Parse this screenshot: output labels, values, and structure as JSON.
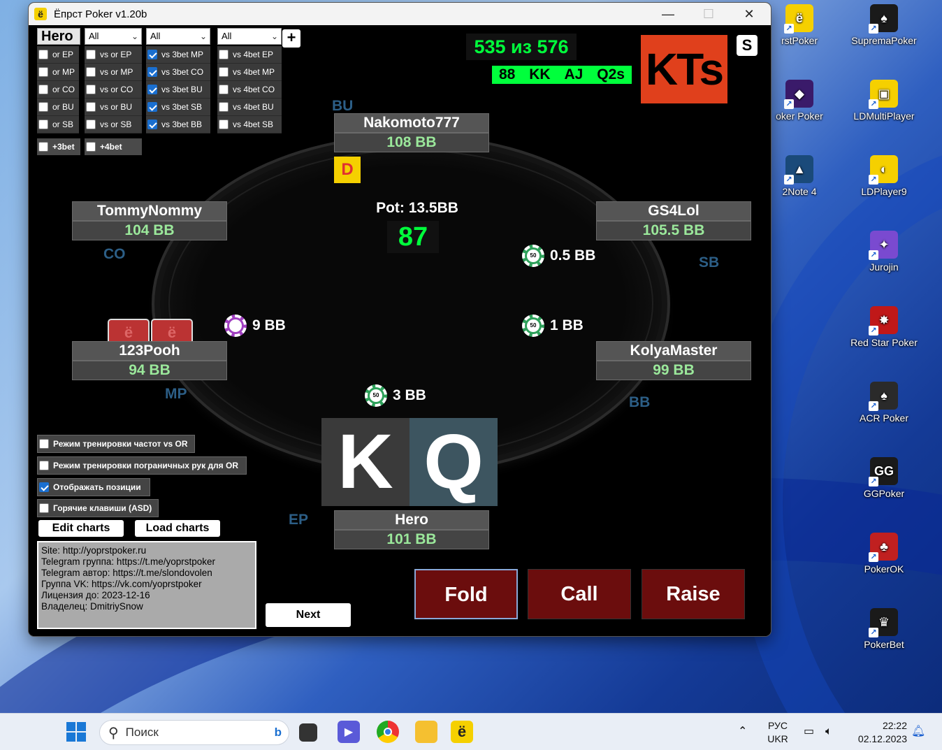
{
  "window": {
    "title": "Ёпрст Poker v1.20b",
    "minimize": "—",
    "maximize": "☐",
    "close": "✕",
    "app_glyph": "ё"
  },
  "filters": {
    "hero": "Hero",
    "dropdowns": [
      "All",
      "All",
      "All"
    ],
    "plus": "+",
    "col1": [
      {
        "label": "or EP",
        "checked": false
      },
      {
        "label": "or MP",
        "checked": false
      },
      {
        "label": "or CO",
        "checked": false
      },
      {
        "label": "or BU",
        "checked": false
      },
      {
        "label": "or SB",
        "checked": false
      }
    ],
    "col2": [
      {
        "label": "vs or EP",
        "checked": false
      },
      {
        "label": "vs or MP",
        "checked": false
      },
      {
        "label": "vs or CO",
        "checked": false
      },
      {
        "label": "vs or BU",
        "checked": false
      },
      {
        "label": "vs or SB",
        "checked": false
      }
    ],
    "col3": [
      {
        "label": "vs 3bet MP",
        "checked": true
      },
      {
        "label": "vs 3bet CO",
        "checked": true
      },
      {
        "label": "vs 3bet BU",
        "checked": true
      },
      {
        "label": "vs 3bet SB",
        "checked": true
      },
      {
        "label": "vs 3bet BB",
        "checked": true
      }
    ],
    "col4": [
      {
        "label": "vs 4bet EP",
        "checked": false
      },
      {
        "label": "vs 4bet MP",
        "checked": false
      },
      {
        "label": "vs 4bet CO",
        "checked": false
      },
      {
        "label": "vs 4bet BU",
        "checked": false
      },
      {
        "label": "vs 4bet SB",
        "checked": false
      }
    ],
    "plus3bet": "+3bet",
    "plus4bet": "+4bet"
  },
  "stats": {
    "counter": "535 из 576",
    "recent": [
      "88",
      "KK",
      "AJ",
      "Q2s"
    ],
    "current_hand": "KTs",
    "s_button": "S"
  },
  "seats": {
    "top": {
      "name": "Nakomoto777",
      "stack": "108 BB",
      "position": "BU"
    },
    "left_top": {
      "name": "TommyNommy",
      "stack": "104 BB",
      "position": "CO"
    },
    "right_top": {
      "name": "GS4Lol",
      "stack": "105.5 BB",
      "position": "SB"
    },
    "left_bottom": {
      "name": "123Pooh",
      "stack": "94 BB",
      "position": "MP"
    },
    "right_bottom": {
      "name": "KolyaMaster",
      "stack": "99 BB",
      "position": "BB"
    },
    "hero": {
      "name": "Hero",
      "stack": "101 BB",
      "position": "EP"
    }
  },
  "dealer": "D",
  "pot": {
    "label": "Pot: 13.5BB",
    "timer": "87"
  },
  "bets": {
    "sb": "0.5 BB",
    "bb": "1 BB",
    "mp": "9 BB",
    "hero": "3 BB",
    "chip_face": "50"
  },
  "card_back_glyph": "ё",
  "hero_cards": [
    {
      "rank": "K",
      "color": "#3a3a3a"
    },
    {
      "rank": "Q",
      "color": "#3d5560"
    }
  ],
  "options": [
    {
      "label": "Режим тренировки частот vs OR",
      "checked": false
    },
    {
      "label": "Режим тренировки пограничных рук для OR",
      "checked": false
    },
    {
      "label": "Отображать позиции",
      "checked": true
    },
    {
      "label": "Горячие клавиши (ASD)",
      "checked": false
    }
  ],
  "buttons": {
    "edit_charts": "Edit charts",
    "load_charts": "Load charts",
    "next": "Next"
  },
  "info_lines": [
    "Site: http://yoprstpoker.ru",
    "Telegram группа: https://t.me/yoprstpoker",
    "Telegram автор: https://t.me/slondovolen",
    "Группа VK: https://vk.com/yoprstpoker",
    "Лицензия до: 2023-12-16",
    "Владелец: DmitriySnow"
  ],
  "actions": {
    "fold": "Fold",
    "call": "Call",
    "raise": "Raise"
  },
  "desktop": {
    "left_col": [
      {
        "label": "rstPoker",
        "color": "#f5d000",
        "glyph": "ё"
      },
      {
        "label": "oker Poker",
        "color": "#3a1a6a",
        "glyph": "◆"
      },
      {
        "label": "2Note 4",
        "color": "#1a4a7a",
        "glyph": "▲"
      }
    ],
    "right_col": [
      {
        "label": "SupremaPoker",
        "color": "#1a1a1a",
        "glyph": "♠"
      },
      {
        "label": "LDMultiPlayer",
        "color": "#f5d000",
        "glyph": "▣"
      },
      {
        "label": "LDPlayer9",
        "color": "#f5d000",
        "glyph": "◐"
      },
      {
        "label": "Jurojin",
        "color": "#7a4ad0",
        "glyph": "✦"
      },
      {
        "label": "Red Star Poker",
        "color": "#c01818",
        "glyph": "✸"
      },
      {
        "label": "ACR Poker",
        "color": "#2a2a2a",
        "glyph": "♠"
      },
      {
        "label": "GGPoker",
        "color": "#1a1a1a",
        "glyph": "GG"
      },
      {
        "label": "PokerOK",
        "color": "#c02020",
        "glyph": "♣"
      },
      {
        "label": "PokerBet",
        "color": "#1a1a1a",
        "glyph": "♛"
      }
    ]
  },
  "taskbar": {
    "search_placeholder": "Поиск",
    "language": "РУС",
    "layout": "UKR",
    "time": "22:22",
    "date": "02.12.2023"
  }
}
